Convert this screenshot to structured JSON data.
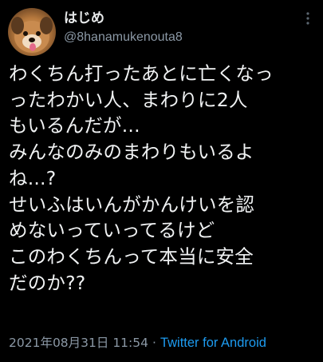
{
  "user": {
    "display_name": "はじめ",
    "handle": "@8hanamukenouta8",
    "avatar_icon": "dog-avatar-icon"
  },
  "more_icon": "more-options-icon",
  "tweet": {
    "lines": [
      "わくちん打ったあとに亡くなっ",
      "ったわかい人、まわりに2人",
      "もいるんだが...",
      "みんなのみのまわりもいるよ",
      "ね...?",
      "せいふはいんがかんけいを認",
      "めないっていってるけど",
      "このわくちんって本当に安全",
      "だのか??"
    ]
  },
  "meta": {
    "timestamp": "2021年08月31日 11:54",
    "separator": "·",
    "source": "Twitter for Android"
  },
  "colors": {
    "background": "#000000",
    "text": "#e7e9ea",
    "secondary": "#8b98a5",
    "link": "#1d9bf0"
  }
}
